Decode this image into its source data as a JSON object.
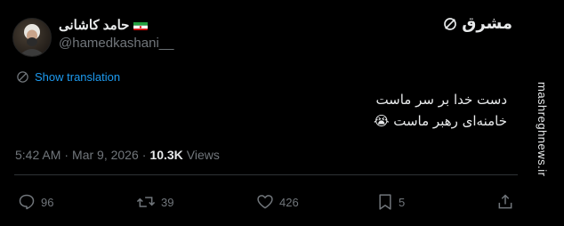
{
  "tweet": {
    "author": {
      "name": "حامد کاشانی",
      "handle": "@hamedkashani__"
    },
    "translation_label": "Show translation",
    "body_lines": [
      "دست خدا بر سر ماست",
      "خامنه‌ای رهبر ماست 😭"
    ],
    "meta": {
      "time": "5:42 AM",
      "separator": "·",
      "date": "Mar 9, 2026",
      "views_count": "10.3K",
      "views_label": "Views"
    },
    "actions": {
      "replies": "96",
      "reposts": "39",
      "likes": "426",
      "bookmarks": "5"
    },
    "icons": {
      "reply": "reply-icon",
      "repost": "repost-icon",
      "like": "heart-icon",
      "bookmark": "bookmark-icon",
      "share": "share-icon",
      "translate": "translate-icon"
    }
  },
  "watermark": {
    "brand_text": "مشرق",
    "site_text": "mashreghnews.ir"
  },
  "colors": {
    "background": "#000000",
    "text_primary": "#e7e9ea",
    "text_secondary": "#71767b",
    "accent": "#1d9bf0",
    "divider": "#2f3336"
  }
}
